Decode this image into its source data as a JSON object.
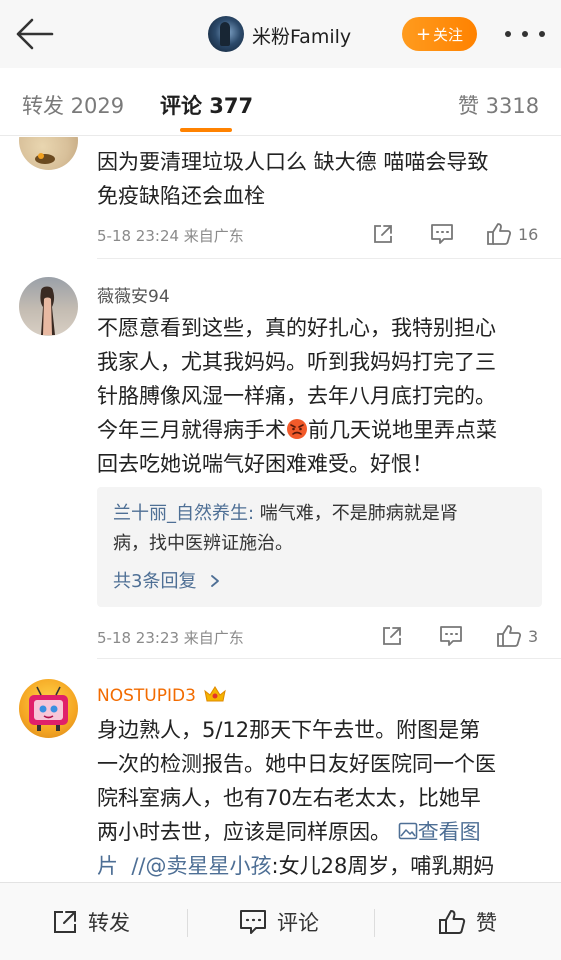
{
  "header": {
    "title": "米粉Family",
    "follow_label": "关注",
    "follow_plus": "+"
  },
  "tabs": {
    "repost": "转发 2029",
    "comments": "评论 377",
    "likes": "赞 3318"
  },
  "comments": [
    {
      "text_lines": [
        "因为要清理垃圾人口么 缺大德 喵喵会导致",
        "免疫缺陷还会血栓"
      ],
      "meta": "5-18 23:24 来自广东",
      "likes": "16"
    },
    {
      "name": "薇薇安94",
      "text_lines": [
        "不愿意看到这些，真的好扎心，我特别担心",
        "我家人，尤其我妈妈。听到我妈妈打完了三",
        "针胳膊像风湿一样痛，去年八月底打完的。",
        "今年三月就得病手术",
        "前几天说地里弄点菜",
        "回去吃她说喘气好困难难受。好恨！"
      ],
      "reply": {
        "user": "兰十丽_自然养生:",
        "text_a": " 喘气难，不是肺病就是肾",
        "text_b": "病，找中医辨证施治。",
        "more": "共3条回复"
      },
      "meta": "5-18 23:23 来自广东",
      "likes": "3"
    },
    {
      "name": "NOSTUPID3",
      "text_lines": [
        "身边熟人，5/12那天下午去世。附图是第",
        "一次的检测报告。她中日友好医院同一个医",
        "院科室病人，也有70左右老太太，比她早",
        "两小时去世，应该是同样原因。"
      ],
      "link_view": "查看图",
      "line5_a": "片",
      "line5_mention": "//@卖星星小孩",
      "line5_b": ":女儿28周岁，哺乳期妈"
    }
  ],
  "bottombar": {
    "repost": "转发",
    "comment": "评论",
    "like": "赞"
  },
  "colors": {
    "accent": "#ff8200",
    "link": "#4e6f95",
    "vip_name": "#f26b00"
  },
  "icons": [
    "back-arrow-icon",
    "more-dots-icon",
    "share-icon",
    "comment-icon",
    "like-icon",
    "angry-emoji-icon",
    "crown-badge-icon",
    "image-icon",
    "chevron-right-icon"
  ]
}
